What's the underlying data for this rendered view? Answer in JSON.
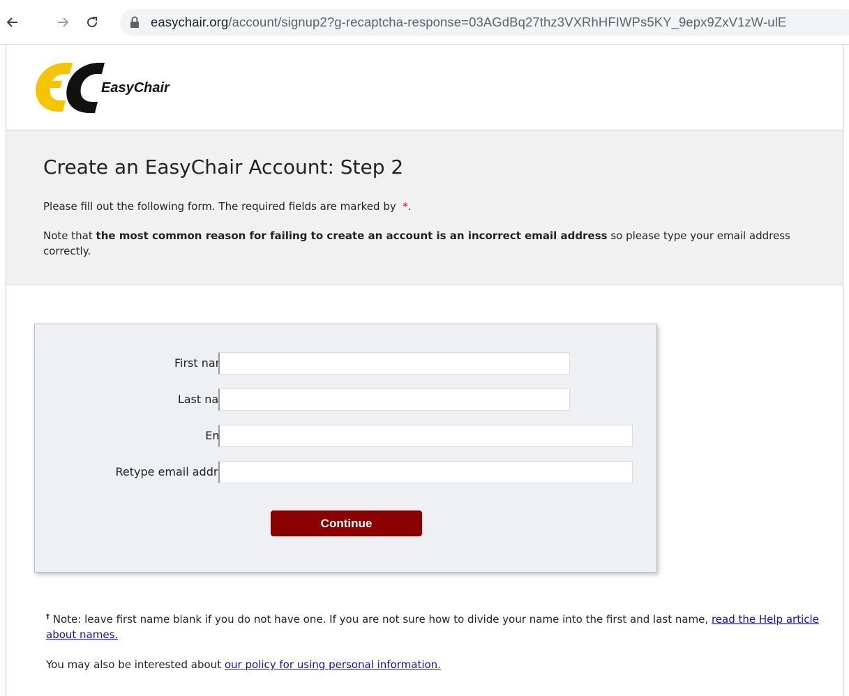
{
  "browser": {
    "url_host": "easychair.org",
    "url_rest": "/account/signup2?g-recaptcha-response=03AGdBq27thz3VXRhHFIWPs5KY_9epx9ZxV1zW-ulE"
  },
  "logo": {
    "text": "EasyChair",
    "colors": {
      "e": "#f5c400",
      "c": "#111111"
    }
  },
  "header": {
    "title": "Create an EasyChair Account: Step 2",
    "intro": "Please fill out the following form. The required fields are marked by",
    "required_marker": "*",
    "intro_end": ".",
    "note_before": "Note that",
    "note_bold": "the most common reason for failing to create an account is an incorrect email address",
    "note_after": "so please type your email address correctly."
  },
  "form": {
    "fields": [
      {
        "label": "First name",
        "sup": "†",
        "colon": ":",
        "value": ""
      },
      {
        "label": "Last name",
        "colon": ":",
        "value": ""
      },
      {
        "label": "Email",
        "colon": ":",
        "value": ""
      },
      {
        "label": "Retype email address",
        "colon": ":",
        "value": ""
      }
    ],
    "required_marker": "*",
    "continue_label": "Continue"
  },
  "footer": {
    "dagger": "†",
    "note_text": "Note: leave first name blank if you do not have one. If you are not sure how to divide your name into the first and last name,",
    "help_link": "read the Help article about names.",
    "policy_prefix": "You may also be interested about",
    "policy_link": "our policy for using personal information."
  },
  "colors": {
    "accent_button": "#8b0000",
    "required": "#e0001a",
    "title_band": "#f1f1f1",
    "link": "#1a0dab"
  }
}
